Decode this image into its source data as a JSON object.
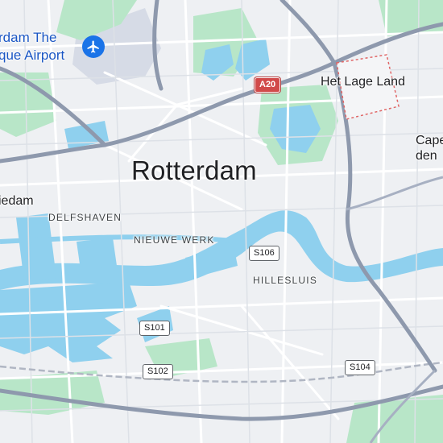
{
  "map": {
    "city_label": "Rotterdam",
    "places": {
      "airport_line1": "rdam The",
      "airport_line2": "que Airport",
      "het_lage_land": "Het Lage Land",
      "cape_line1": "Cape",
      "cape_line2": "den",
      "schiedam": "iedam"
    },
    "districts": {
      "delfshaven": "DELFSHAVEN",
      "nieuwe_werk": "NIEUWE WERK",
      "hillesluis": "HILLESLUIS"
    },
    "roads": {
      "a20": "A20",
      "s106": "S106",
      "s101": "S101",
      "s102": "S102",
      "s104": "S104"
    },
    "icons": {
      "airport": "airplane-icon"
    },
    "colors": {
      "land": "#eef0f3",
      "water": "#8fd0ee",
      "park": "#b8e6c8",
      "highway": "#8e99ad",
      "road": "#ffffff",
      "motorway_shield": "#d14a4a",
      "airport_blue": "#1a73e8",
      "boundary": "#e06666"
    }
  }
}
